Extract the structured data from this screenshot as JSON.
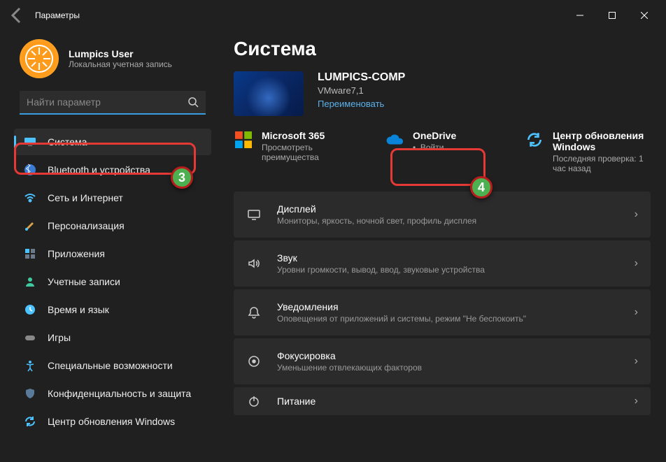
{
  "window": {
    "title": "Параметры"
  },
  "user": {
    "name": "Lumpics User",
    "sub": "Локальная учетная запись"
  },
  "search": {
    "placeholder": "Найти параметр"
  },
  "nav": {
    "system": "Система",
    "bluetooth": "Bluetooth и устройства",
    "network": "Сеть и Интернет",
    "personalization": "Персонализация",
    "apps": "Приложения",
    "accounts": "Учетные записи",
    "time": "Время и язык",
    "gaming": "Игры",
    "accessibility": "Специальные возможности",
    "privacy": "Конфиденциальность и защита",
    "update": "Центр обновления Windows"
  },
  "page": {
    "heading": "Система",
    "device_name": "LUMPICS-COMP",
    "device_meta": "VMware7,1",
    "rename": "Переименовать"
  },
  "cards": {
    "m365": {
      "title": "Microsoft 365",
      "sub": "Просмотреть преимущества"
    },
    "onedrive": {
      "title": "OneDrive",
      "sub": "Войти",
      "bullet": "•"
    },
    "update": {
      "title": "Центр обновления Windows",
      "sub": "Последняя проверка: 1 час назад"
    }
  },
  "settings": {
    "display": {
      "title": "Дисплей",
      "sub": "Мониторы, яркость, ночной свет, профиль дисплея"
    },
    "sound": {
      "title": "Звук",
      "sub": "Уровни громкости, вывод, ввод, звуковые устройства"
    },
    "notif": {
      "title": "Уведомления",
      "sub": "Оповещения от приложений и системы, режим \"Не беспокоить\""
    },
    "focus": {
      "title": "Фокусировка",
      "sub": "Уменьшение отвлекающих факторов"
    },
    "power": {
      "title": "Питание",
      "sub": ""
    }
  },
  "badges": {
    "b3": "3",
    "b4": "4"
  }
}
